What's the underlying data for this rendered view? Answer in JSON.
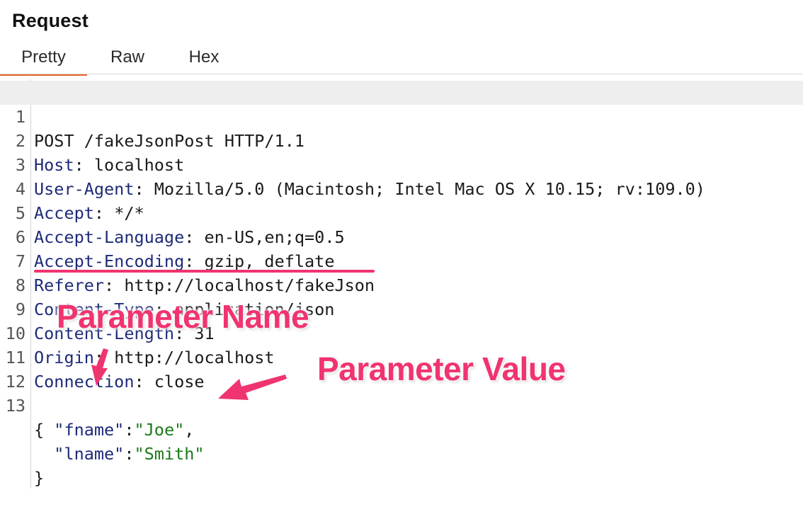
{
  "panel": {
    "title": "Request"
  },
  "tabs": [
    {
      "label": "Pretty",
      "active": true
    },
    {
      "label": "Raw",
      "active": false
    },
    {
      "label": "Hex",
      "active": false
    }
  ],
  "request": {
    "lines": [
      {
        "num": "1",
        "text": "POST /fakeJsonPost HTTP/1.1"
      },
      {
        "num": "2",
        "name": "Host",
        "value": " localhost"
      },
      {
        "num": "3",
        "name": "User-Agent",
        "value": " Mozilla/5.0 (Macintosh; Intel Mac OS X 10.15; rv:109.0)"
      },
      {
        "num": "4",
        "name": "Accept",
        "value": " */*"
      },
      {
        "num": "5",
        "name": "Accept-Language",
        "value": " en-US,en;q=0.5"
      },
      {
        "num": "6",
        "name": "Accept-Encoding",
        "value": " gzip, deflate"
      },
      {
        "num": "7",
        "name": "Referer",
        "value": " http://localhost/fakeJson"
      },
      {
        "num": "8",
        "name": "Content-Type",
        "value": " application/json"
      },
      {
        "num": "9",
        "name": "Content-Length",
        "value": " 31"
      },
      {
        "num": "10",
        "name": "Origin",
        "value": " http://localhost"
      },
      {
        "num": "11",
        "name": "Connection",
        "value": " close"
      },
      {
        "num": "12",
        "text": ""
      },
      {
        "num": "13",
        "text": "{"
      }
    ],
    "body": {
      "fname_key": "\"fname\"",
      "fname_value": "\"Joe\"",
      "lname_key": "\"lname\"",
      "lname_value": "\"Smith\"",
      "close": "}"
    }
  },
  "annotations": {
    "name_label": "Parameter Name",
    "value_label": "Parameter Value",
    "color": "#f0346f"
  },
  "colors": {
    "tab_accent": "#e8632b",
    "header_name": "#1d2a78",
    "string_value": "#1a7a1a"
  }
}
